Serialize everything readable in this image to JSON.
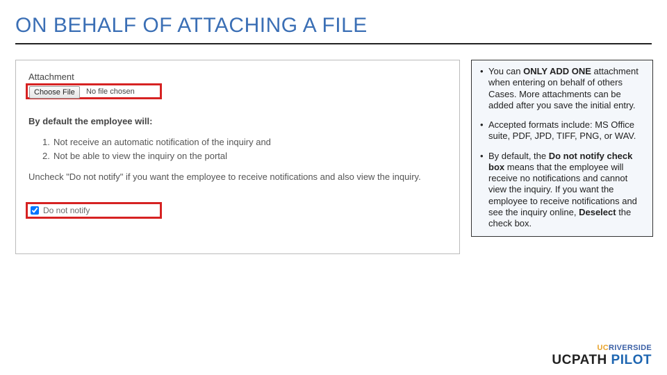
{
  "title": "ON BEHALF OF ATTACHING A FILE",
  "screenshot": {
    "attachment_label": "Attachment",
    "choose_button": "Choose File",
    "no_file_text": "No file chosen",
    "default_header": "By default the employee will:",
    "list": {
      "item1_num": "1.",
      "item1_text": "Not receive an automatic notification of the inquiry and",
      "item2_num": "2.",
      "item2_text": "Not be able to view the inquiry on the portal"
    },
    "uncheck_note": "Uncheck \"Do not notify\" if you want the employee to receive notifications and also view the inquiry.",
    "do_not_notify_label": "Do not notify"
  },
  "info": {
    "bullet1_pre": "You can ",
    "bullet1_bold": "ONLY ADD ONE",
    "bullet1_post": " attachment when entering on behalf of others Cases. More attachments can be added after you save the initial entry.",
    "bullet2": "Accepted formats include: MS Office suite, PDF, JPD, TIFF, PNG, or WAV.",
    "bullet3_pre": "By default, the ",
    "bullet3_bold1": "Do not notify check box",
    "bullet3_mid": " means that the employee will receive no notifications and cannot view the inquiry. If you want the employee to receive notifications and see the inquiry online, ",
    "bullet3_bold2": "Deselect",
    "bullet3_post": " the check box."
  },
  "logo": {
    "uc": "UC",
    "riverside": "RIVERSIDE",
    "ucpath": "UCPATH",
    "pilot": "PILOT"
  }
}
